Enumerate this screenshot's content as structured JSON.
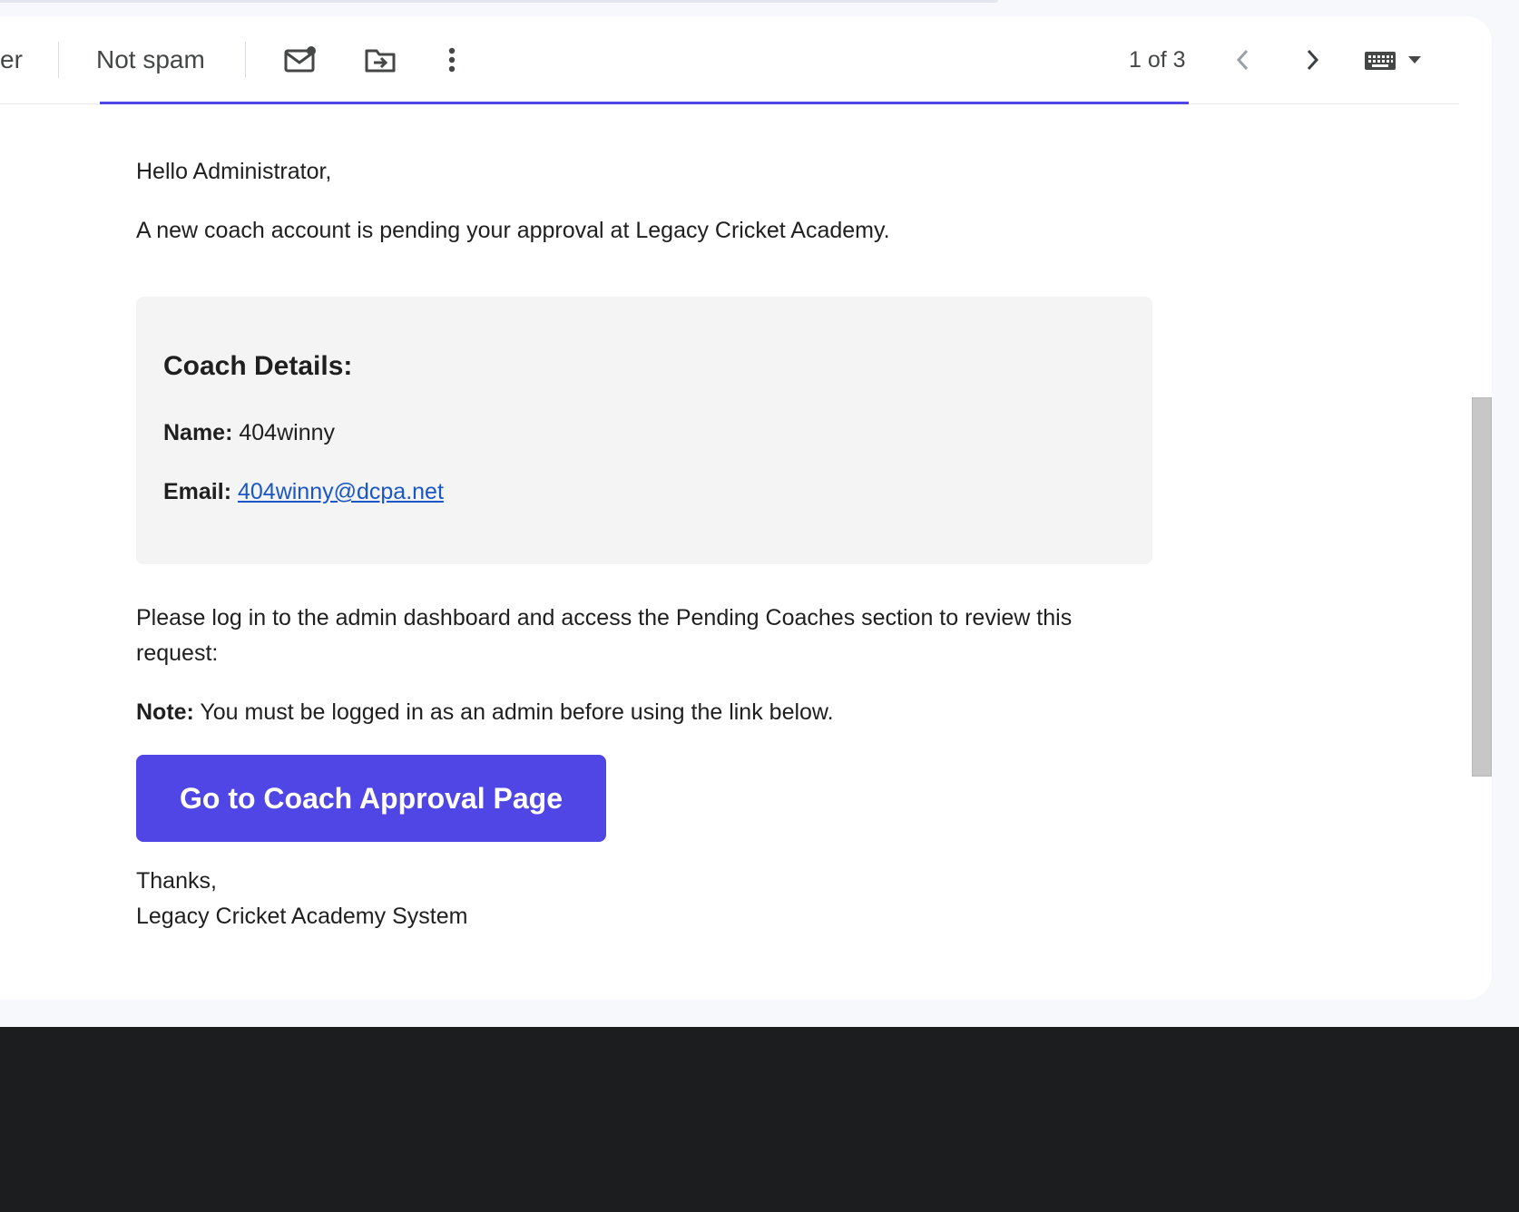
{
  "toolbar": {
    "partial_button_label": "er",
    "not_spam_label": "Not spam",
    "pagination": "1 of 3"
  },
  "icons": {
    "mark_unread": "mail-dot-icon",
    "move_to": "folder-move-icon",
    "more": "more-vert-icon",
    "prev": "chevron-left-icon",
    "next": "chevron-right-icon",
    "keyboard": "keyboard-icon",
    "dropdown": "caret-down-icon"
  },
  "colors": {
    "accent": "#4f46e5",
    "link": "#1a56c7",
    "details_bg": "#f4f4f4"
  },
  "email": {
    "greeting": "Hello Administrator,",
    "intro": "A new coach account is pending your approval at Legacy Cricket Academy.",
    "details": {
      "heading": "Coach Details:",
      "name_label": "Name:",
      "name_value": "404winny",
      "email_label": "Email:",
      "email_value": "404winny@dcpa.net"
    },
    "instruction": "Please log in to the admin dashboard and access the Pending Coaches section to review this request:",
    "note_label": "Note:",
    "note_text": "You must be logged in as an admin before using the link below.",
    "cta_label": "Go to Coach Approval Page",
    "signoff": "Thanks,",
    "signature": "Legacy Cricket Academy System"
  }
}
